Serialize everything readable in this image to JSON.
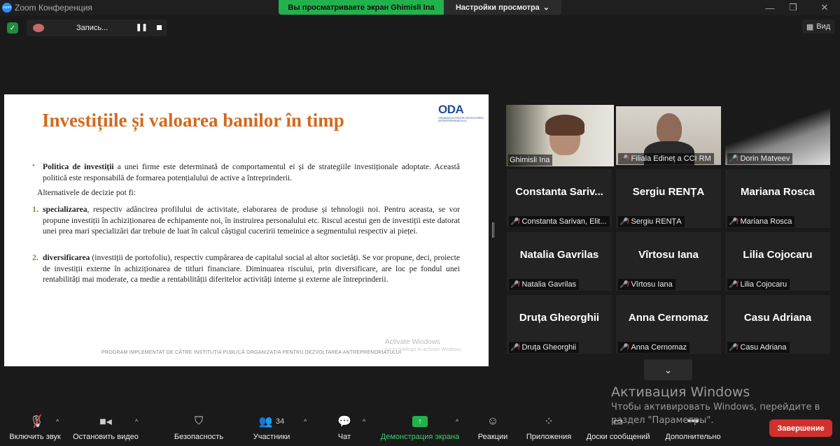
{
  "window": {
    "title": "Zoom Конференция",
    "logo_text": "zoom"
  },
  "banner": {
    "viewing": "Вы просматриваете экран Ghimisli Ina",
    "settings": "Настройки просмотра"
  },
  "recording": {
    "label": "Запись..."
  },
  "view_button": {
    "label": "Вид"
  },
  "slide": {
    "title": "Investițiile și valoarea banilor în timp",
    "logo": {
      "main": "ODA",
      "sub": "ORGANIZAȚIA PENTRU DEZVOLTAREA ANTREPRENORIATULUI"
    },
    "p1_bold": "Politica de investiții",
    "p1_rest": " a unei firme este determinată de comportamentul ei și de strategiile investiționale adoptate. Această politică este responsabilă de formarea potențialului de active a întreprinderii.",
    "p2": "Alternativele de decizie pot fi:",
    "item1_num": "1.",
    "item1_bold": "specializarea",
    "item1_rest": ", respectiv adâncirea profilului de activitate, elaborarea de produse și tehnologii noi. Pentru aceasta, se vor propune investiții în achiziționarea de echipamente noi, în instruirea personalului etc. Riscul acestui gen de investiții este datorat unei prea mari specializări dar trebuie de luat în calcul câștigul cuceririi temeinice a segmentului respectiv ai pieței.",
    "item2_num": "2.",
    "item2_bold": "diversificarea",
    "item2_rest": " (investiții de portofoliu), respectiv cumpărarea de capitalul social al altor societăți. Se vor propune, deci, proiecte de investiții externe în achiziționarea de titluri financiare. Diminuarea riscului, prin diversificare, are loc pe fondul unei rentabilități mai moderate, ca medie a rentabilității diferitelor activități interne și externe ale întreprinderii.",
    "footer": "PROGRAM IMPLEMENTAT DE CĂTRE INSTITUȚIA PUBLICĂ ORGANIZAȚIA PENTRU DEZVOLTAREA ANTREPRENORIATULUI",
    "activate_title": "Activate Windows",
    "activate_sub": "Go to Settings to activate Windows."
  },
  "participants": [
    {
      "name": "Ghimisli Ina",
      "video": true,
      "muted": false,
      "active": true
    },
    {
      "name": "Filiala Edineț a CCI RM",
      "video": true,
      "muted": true
    },
    {
      "name": "Dorin Matveev",
      "video": true,
      "muted": true
    },
    {
      "display": "Constanta  Sariv...",
      "name": "Constanta Sarivan, Elit...",
      "muted": true
    },
    {
      "display": "Sergiu RENȚA",
      "name": "Sergiu RENȚA",
      "muted": true
    },
    {
      "display": "Mariana Rosca",
      "name": "Mariana Rosca",
      "muted": true
    },
    {
      "display": "Natalia Gavrilas",
      "name": "Natalia Gavrilas",
      "muted": true
    },
    {
      "display": "Vîrtosu Iana",
      "name": "Vîrtosu Iana",
      "muted": true
    },
    {
      "display": "Lilia Cojocaru",
      "name": "Lilia Cojocaru",
      "muted": true
    },
    {
      "display": "Druța Gheorghii",
      "name": "Druța Gheorghii",
      "muted": true
    },
    {
      "display": "Anna Cernomaz",
      "name": "Anna Cernomaz",
      "muted": true
    },
    {
      "display": "Casu Adriana",
      "name": "Casu Adriana",
      "muted": true
    }
  ],
  "activation": {
    "title": "Активация Windows",
    "line1": "Чтобы активировать Windows, перейдите в",
    "line2": "раздел \"Параметры\"."
  },
  "toolbar": {
    "unmute": "Включить звук",
    "stop_video": "Остановить видео",
    "security": "Безопасность",
    "participants": "Участники",
    "participants_count": "34",
    "chat": "Чат",
    "share": "Демонстрация экрана",
    "reactions": "Реакции",
    "apps": "Приложения",
    "whiteboards": "Доски сообщений",
    "more": "Дополнительно",
    "end": "Завершение"
  },
  "colors": {
    "share_green": "#22b14c",
    "end_red": "#d0312d",
    "active_speaker": "#e1e454",
    "slide_title": "#d2691e"
  }
}
